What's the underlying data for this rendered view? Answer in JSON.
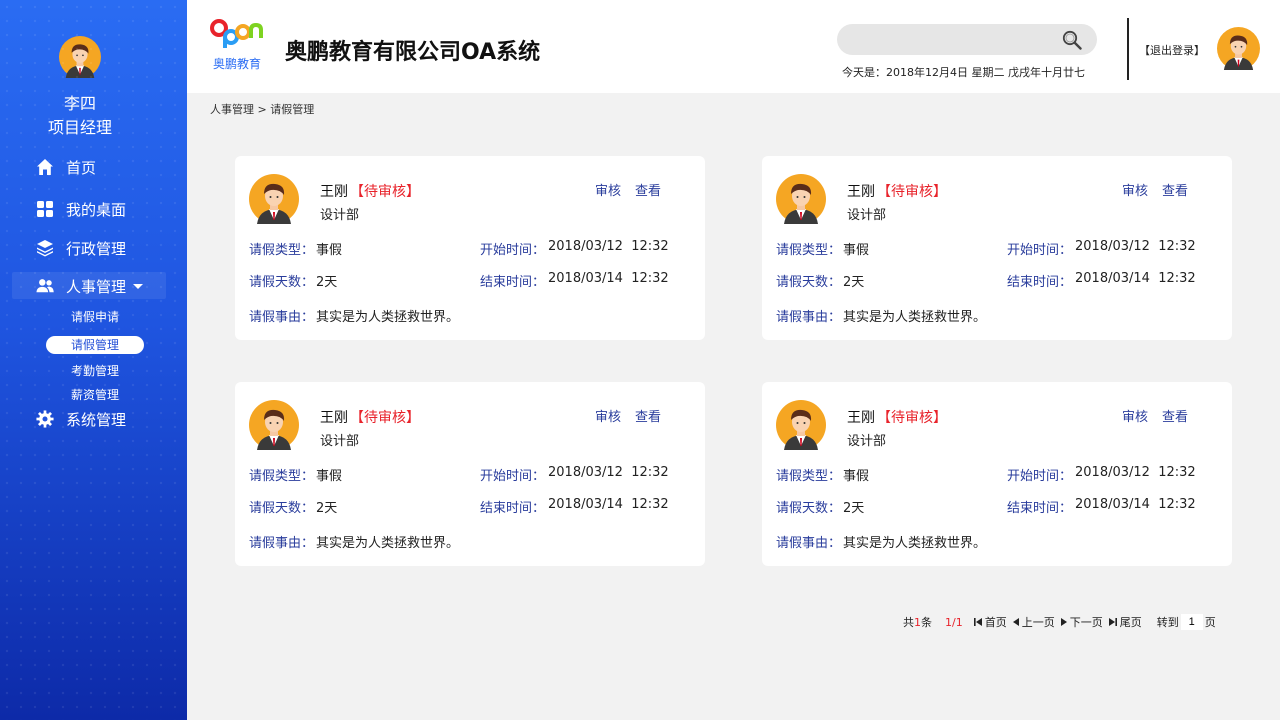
{
  "user": {
    "name": "李四",
    "title": "项目经理"
  },
  "nav": {
    "home": "首页",
    "desktop": "我的桌面",
    "admin": "行政管理",
    "hr": "人事管理",
    "hr_sub": [
      "请假申请",
      "请假管理",
      "考勤管理",
      "薪资管理"
    ],
    "system": "系统管理"
  },
  "header": {
    "logo_top": "Open",
    "logo_bottom": "奥鹏教育",
    "title": "奥鹏教育有限公司OA系统",
    "search_placeholder": "",
    "date": "今天是：2018年12月4日   星期二   戊戌年十月廿七",
    "logout": "【退出登录】"
  },
  "breadcrumb": "人事管理 > 请假管理",
  "labels": {
    "type": "请假类型：",
    "days": "请假天数：",
    "reason": "请假事由：",
    "start": "开始时间：",
    "end": "结束时间：",
    "review": "审核",
    "view": "查看"
  },
  "cards": [
    {
      "name": "王刚",
      "status": "【待审核】",
      "dept": "设计部",
      "type": "事假",
      "days": "2天",
      "start": "2018/03/12  12:32",
      "end": "2018/03/14  12:32",
      "reason": "其实是为人类拯救世界。"
    },
    {
      "name": "王刚",
      "status": "【待审核】",
      "dept": "设计部",
      "type": "事假",
      "days": "2天",
      "start": "2018/03/12  12:32",
      "end": "2018/03/14  12:32",
      "reason": "其实是为人类拯救世界。"
    },
    {
      "name": "王刚",
      "status": "【待审核】",
      "dept": "设计部",
      "type": "事假",
      "days": "2天",
      "start": "2018/03/12  12:32",
      "end": "2018/03/14  12:32",
      "reason": "其实是为人类拯救世界。"
    },
    {
      "name": "王刚",
      "status": "【待审核】",
      "dept": "设计部",
      "type": "事假",
      "days": "2天",
      "start": "2018/03/12  12:32",
      "end": "2018/03/14  12:32",
      "reason": "其实是为人类拯救世界。"
    }
  ],
  "pager": {
    "total_prefix": "共",
    "total": "1",
    "total_suffix": "条",
    "page": "1/1",
    "first": "首页",
    "prev": "上一页",
    "next": "下一页",
    "last": "尾页",
    "goto": "转到",
    "goto_value": "1",
    "page_unit": "页"
  },
  "colors": {
    "sidebar_top": "#2a6cf3",
    "sidebar_bottom": "#0d2aa8",
    "label_blue": "#2a3d9c",
    "status_red": "#e8232b"
  }
}
